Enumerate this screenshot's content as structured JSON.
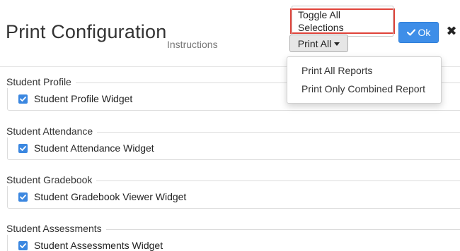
{
  "header": {
    "title": "Print Configuration",
    "instructions": "Instructions",
    "toggle_label": "Toggle All Selections",
    "print_all_label": "Print All",
    "ok_label": "Ok"
  },
  "dropdown": {
    "items": [
      "Print All Reports",
      "Print Only Combined Report"
    ]
  },
  "sections": [
    {
      "legend": "Student Profile",
      "widget": "Student Profile Widget",
      "checked": true
    },
    {
      "legend": "Student Attendance",
      "widget": "Student Attendance Widget",
      "checked": true
    },
    {
      "legend": "Student Gradebook",
      "widget": "Student Gradebook Viewer Widget",
      "checked": true
    },
    {
      "legend": "Student Assessments",
      "widget": "Student Assessments Widget",
      "checked": true
    }
  ],
  "colors": {
    "primary": "#3e8ee8",
    "highlight_border": "#e0433a",
    "checkbox": "#3b87e0"
  }
}
